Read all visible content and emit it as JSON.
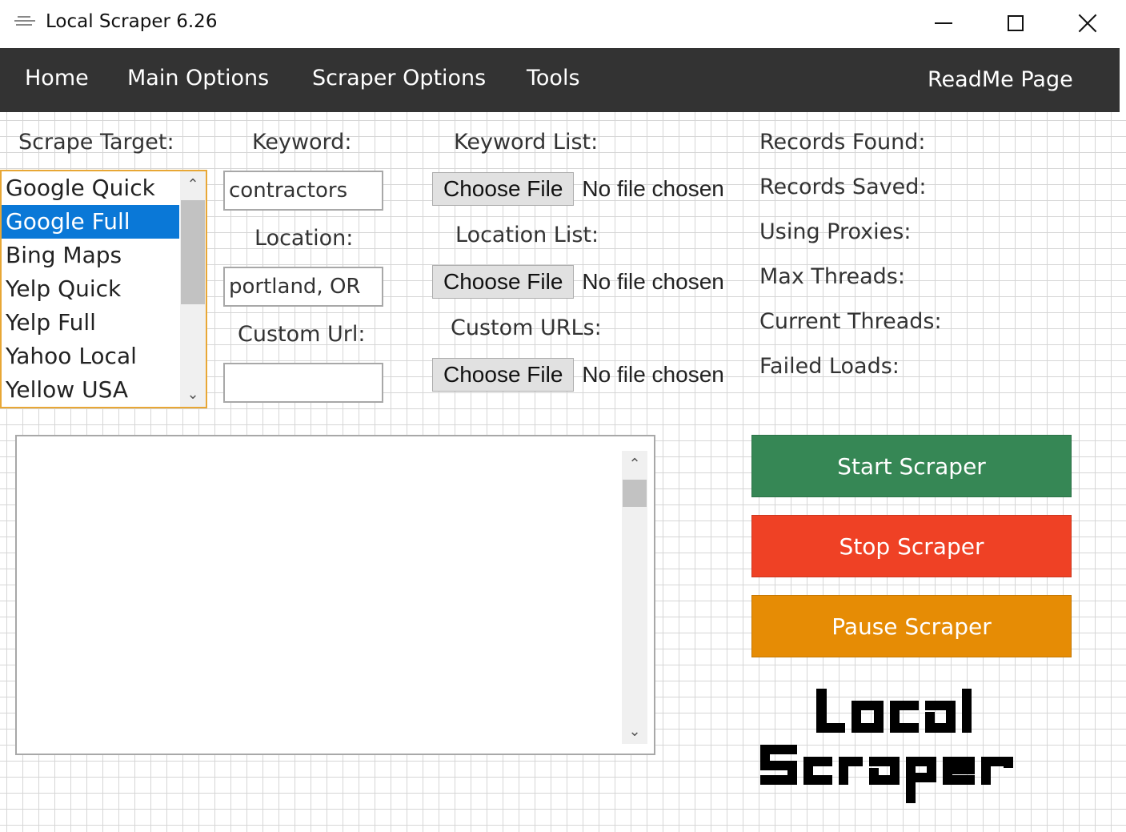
{
  "window": {
    "title": "Local Scraper 6.26"
  },
  "nav": {
    "items": [
      "Home",
      "Main Options",
      "Scraper Options",
      "Tools"
    ],
    "right_item": "ReadMe Page"
  },
  "form": {
    "scrape_target_label": "Scrape Target:",
    "scrape_targets": [
      "Google Quick",
      "Google Full",
      "Bing Maps",
      "Yelp Quick",
      "Yelp Full",
      "Yahoo Local",
      "Yellow USA"
    ],
    "selected_target": "Google Full",
    "keyword_label": "Keyword:",
    "keyword_value": "contractors",
    "location_label": "Location:",
    "location_value": "portland, OR",
    "custom_url_label": "Custom Url:",
    "custom_url_value": "",
    "keyword_list_label": "Keyword List:",
    "location_list_label": "Location List:",
    "custom_urls_label": "Custom URLs:",
    "choose_file_label": "Choose File",
    "no_file_text": "No file chosen"
  },
  "stats": {
    "records_found": "Records Found:",
    "records_saved": "Records Saved:",
    "using_proxies": "Using Proxies:",
    "max_threads": "Max Threads:",
    "current_threads": "Current Threads:",
    "failed_loads": "Failed Loads:"
  },
  "log": {
    "value": ""
  },
  "actions": {
    "start": "Start Scraper",
    "stop": "Stop Scraper",
    "pause": "Pause Scraper"
  },
  "colors": {
    "navbar": "#333333",
    "start": "#368755",
    "stop": "#ef4125",
    "pause": "#e68c05",
    "selected": "#0a78d7",
    "listbox_border": "#e8a735"
  },
  "logo": {
    "line1": "Local",
    "line2": "Scraper"
  }
}
